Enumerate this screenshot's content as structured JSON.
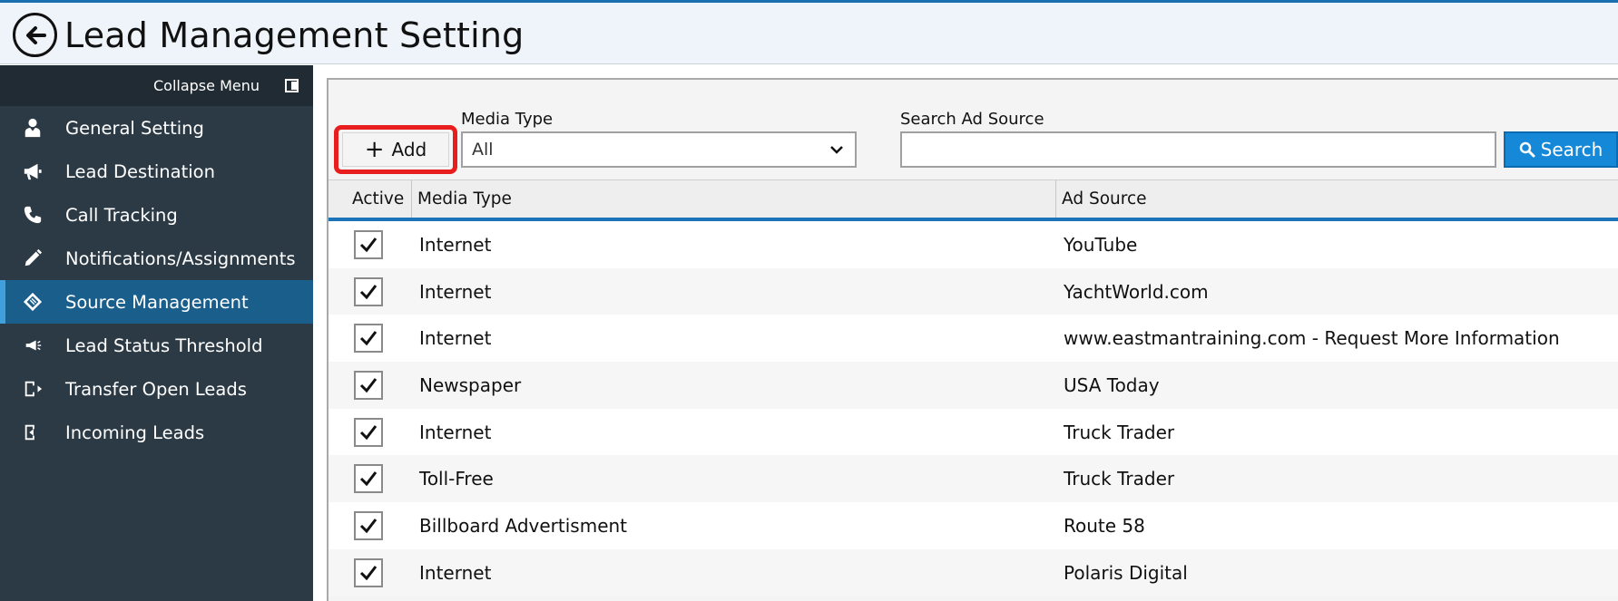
{
  "header": {
    "title": "Lead Management Setting"
  },
  "sidebar": {
    "collapse_label": "Collapse Menu",
    "items": [
      {
        "label": "General Setting",
        "icon": "user-tie-icon"
      },
      {
        "label": "Lead Destination",
        "icon": "megaphone-icon"
      },
      {
        "label": "Call Tracking",
        "icon": "phone-icon"
      },
      {
        "label": "Notifications/Assignments",
        "icon": "pencil-icon"
      },
      {
        "label": "Source Management",
        "icon": "ticket-icon",
        "active": true
      },
      {
        "label": "Lead Status Threshold",
        "icon": "megaphone-small-icon"
      },
      {
        "label": "Transfer Open Leads",
        "icon": "transfer-icon"
      },
      {
        "label": "Incoming Leads",
        "icon": "incoming-icon"
      }
    ]
  },
  "toolbar": {
    "add_label": "Add",
    "media_type_label": "Media Type",
    "media_type_value": "All",
    "search_label": "Search Ad Source",
    "search_value": "",
    "search_button": "Search"
  },
  "table": {
    "headers": {
      "active": "Active",
      "media_type": "Media Type",
      "ad_source": "Ad Source"
    },
    "rows": [
      {
        "active": true,
        "media_type": "Internet",
        "ad_source": "YouTube"
      },
      {
        "active": true,
        "media_type": "Internet",
        "ad_source": "YachtWorld.com"
      },
      {
        "active": true,
        "media_type": "Internet",
        "ad_source": "www.eastmantraining.com - Request More Information"
      },
      {
        "active": true,
        "media_type": "Newspaper",
        "ad_source": "USA Today"
      },
      {
        "active": true,
        "media_type": "Internet",
        "ad_source": "Truck Trader"
      },
      {
        "active": true,
        "media_type": "Toll-Free",
        "ad_source": "Truck Trader"
      },
      {
        "active": true,
        "media_type": "Billboard Advertisment",
        "ad_source": "Route 58"
      },
      {
        "active": true,
        "media_type": "Internet",
        "ad_source": "Polaris Digital"
      }
    ]
  },
  "colors": {
    "accent": "#1589d8",
    "sidebar_bg": "#2c3a45",
    "active_nav": "#1a5e8c",
    "highlight": "#e81d1d"
  }
}
